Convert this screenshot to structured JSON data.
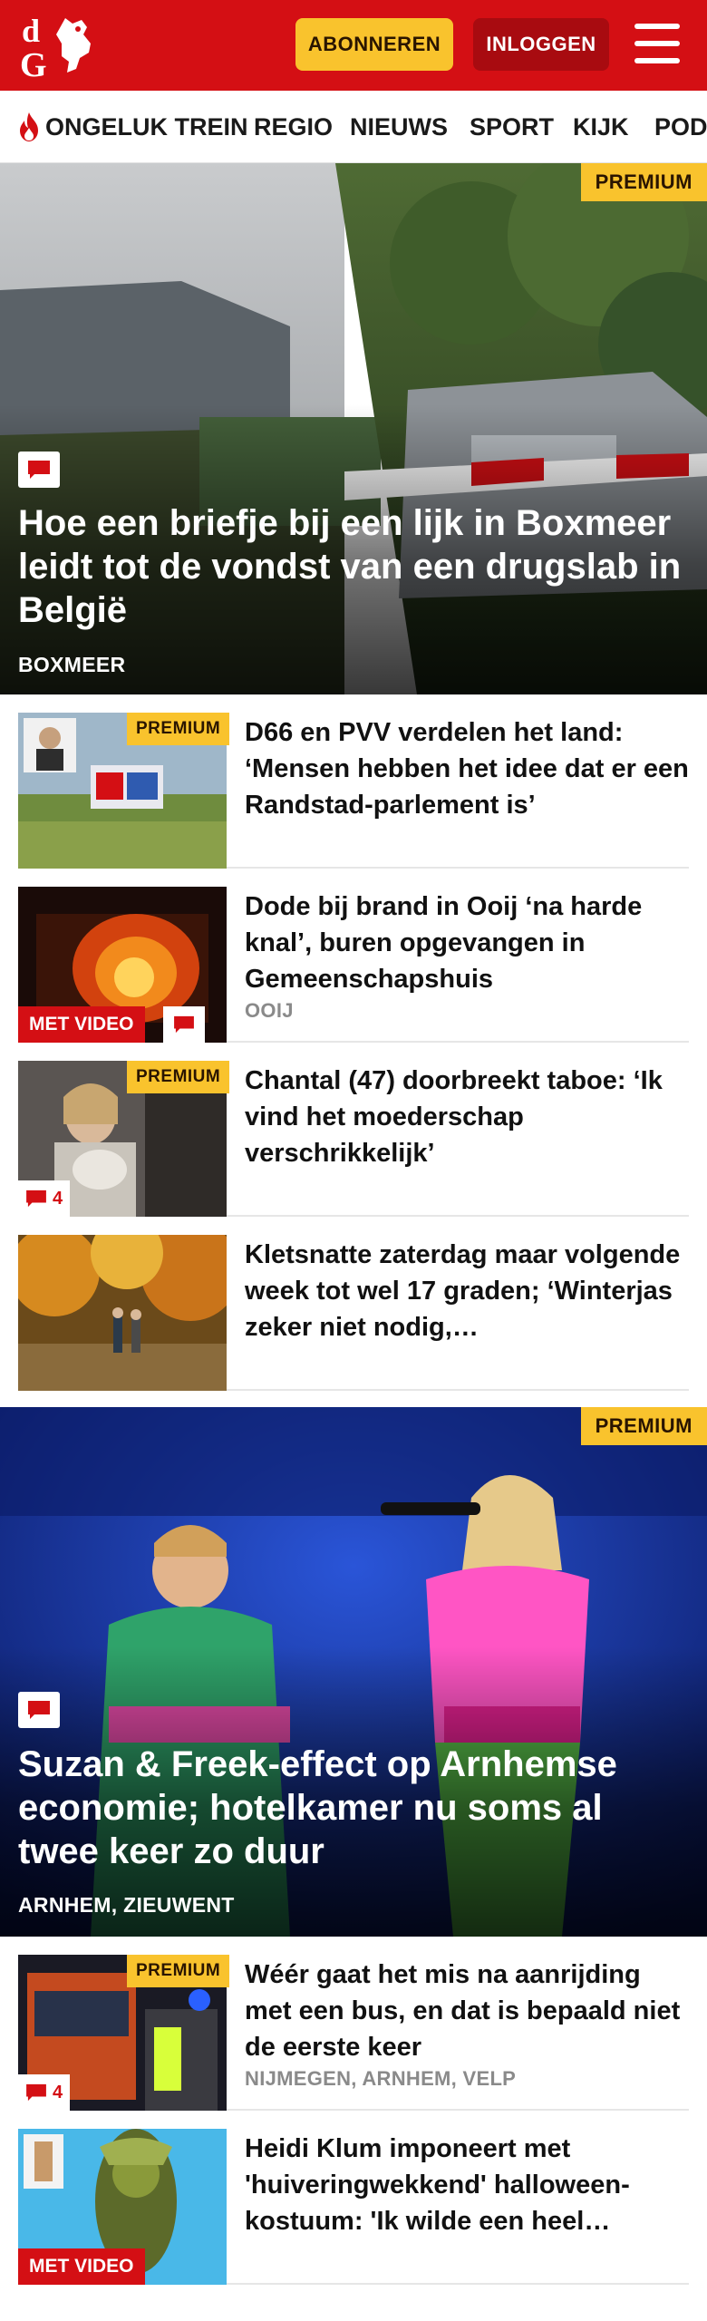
{
  "header": {
    "logo_text": "dG",
    "subscribe_label": "ABONNEREN",
    "login_label": "INLOGGEN"
  },
  "nav": {
    "items": [
      "ONGELUK TREIN",
      "REGIO",
      "NIEUWS",
      "SPORT",
      "KIJK",
      "POD"
    ]
  },
  "hero1": {
    "premium": "PREMIUM",
    "title": "Hoe een briefje bij een lijk in Boxmeer leidt tot de vondst van een drugslab in België",
    "location": "BOXMEER"
  },
  "articles": [
    {
      "title": "D66 en PVV verdelen het land: ‘Mensen hebben het idee dat er een Randstad-parlement is’",
      "premium": "PREMIUM"
    },
    {
      "title": "Dode bij brand in Ooij ‘na harde knal’, buren opgevangen in Gemeenschapshuis",
      "location": "OOIJ",
      "video": "MET VIDEO"
    },
    {
      "title": "Chantal (47) doorbreekt taboe: ‘Ik vind het moederschap verschrikkelijk’",
      "premium": "PREMIUM",
      "comments": "4"
    },
    {
      "title": "Kletsnatte zaterdag maar volgende week tot wel 17 graden; ‘Winterjas zeker niet nodig,…"
    }
  ],
  "hero2": {
    "premium": "PREMIUM",
    "title": "Suzan & Freek-effect op Arnhemse economie; hotelkamer nu soms al twee keer zo duur",
    "location": "ARNHEM, ZIEUWENT"
  },
  "articles2": [
    {
      "title": "Wéér gaat het mis na aanrijding met een bus, en dat is bepaald niet de eerste keer",
      "location": "NIJMEGEN, ARNHEM, VELP",
      "premium": "PREMIUM",
      "comments": "4"
    },
    {
      "title": "Heidi Klum imponeert met 'huiveringwekkend' halloween-kostuum: 'Ik wilde een heel…",
      "video": "MET VIDEO"
    }
  ],
  "colors": {
    "brand_red": "#d40f14",
    "premium_yellow": "#f9c32d",
    "location_gray": "#8a8a8a"
  }
}
